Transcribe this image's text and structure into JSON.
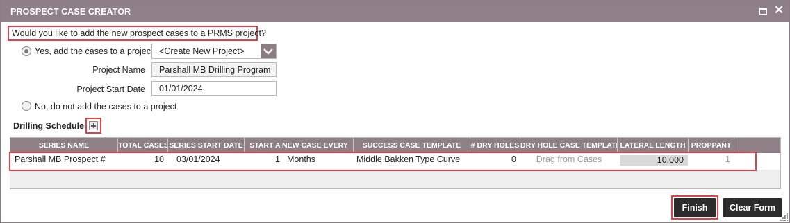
{
  "window": {
    "title": "PROSPECT CASE CREATOR",
    "maximize_icon": "maximize-icon",
    "close_icon": "close-icon"
  },
  "question": "Would you like to add the new prospect cases to a PRMS project?",
  "options": {
    "yes_label": "Yes, add the cases to a project",
    "yes_selected": true,
    "no_label": "No, do not add the cases to a project",
    "no_selected": false
  },
  "project_select": {
    "value": "<Create New Project>",
    "icon": "chevron-down-icon"
  },
  "project_name": {
    "label": "Project Name",
    "value": "Parshall MB Drilling Program"
  },
  "project_start_date": {
    "label": "Project Start Date",
    "value": "01/01/2024"
  },
  "drilling_schedule": {
    "label": "Drilling Schedule",
    "add_icon": "add-row-icon",
    "columns": [
      "SERIES NAME",
      "TOTAL CASES",
      "SERIES START DATE",
      "START A NEW CASE EVERY",
      "SUCCESS CASE TEMPLATE",
      "# DRY HOLES",
      "DRY HOLE CASE TEMPLATE",
      "LATERAL LENGTH",
      "PROPPANT"
    ],
    "rows": [
      {
        "series_name": "Parshall MB Prospect #",
        "total_cases": "10",
        "series_start_date": "03/01/2024",
        "interval_count": "1",
        "interval_unit": "Months",
        "success_case_template": "Middle Bakken Type Curve",
        "dry_holes": "0",
        "dry_hole_case_template": "Drag from Cases",
        "lateral_length": "10,000",
        "proppant": "1"
      }
    ]
  },
  "buttons": {
    "finish": "Finish",
    "clear_form": "Clear Form"
  },
  "colors": {
    "titlebar": "#8f7f86",
    "highlight": "#e2414a",
    "button": "#2c2c2c"
  }
}
